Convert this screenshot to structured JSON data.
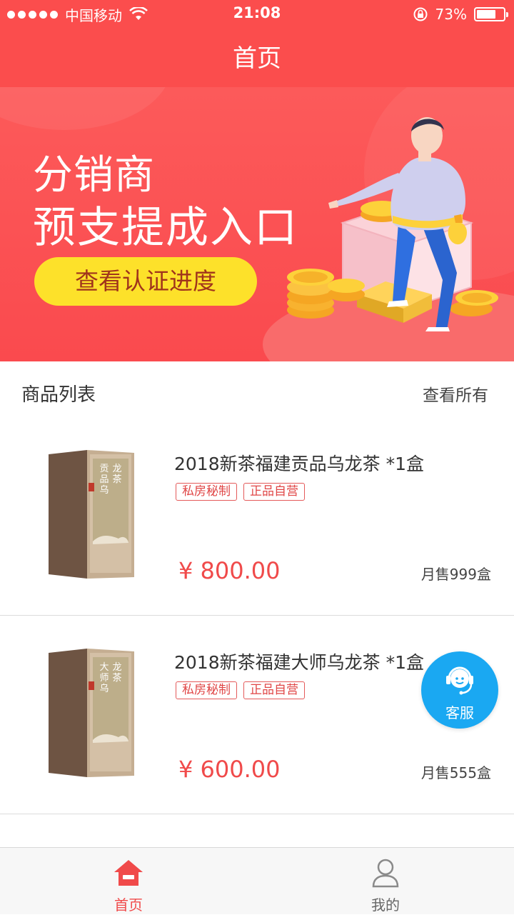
{
  "status_bar": {
    "carrier": "中国移动",
    "time": "21:08",
    "battery": "73%",
    "battery_level": 0.73
  },
  "header": {
    "title": "首页"
  },
  "banner": {
    "line1": "分销商",
    "line2": "预支提成入口",
    "button_label": "查看认证进度"
  },
  "list": {
    "title": "商品列表",
    "view_all": "查看所有"
  },
  "products": [
    {
      "name": "2018新茶福建贡品乌龙茶 *1盒",
      "tags": [
        "私房秘制",
        "正品自营"
      ],
      "price": "¥ 800.00",
      "sold": "月售999盒",
      "box_text": "贡品乌龙茶"
    },
    {
      "name": "2018新茶福建大师乌龙茶 *1盒",
      "tags": [
        "私房秘制",
        "正品自营"
      ],
      "price": "¥ 600.00",
      "sold": "月售555盒",
      "box_text": "大师乌龙茶"
    }
  ],
  "service": {
    "label": "客服"
  },
  "tabbar": {
    "tabs": [
      {
        "label": "首页",
        "icon": "home-icon",
        "active": true
      },
      {
        "label": "我的",
        "icon": "user-icon",
        "active": false
      }
    ]
  },
  "colors": {
    "brand": "#fb4d4d",
    "price": "#f04a4a",
    "button": "#fde12a",
    "service": "#1aa8f2"
  }
}
